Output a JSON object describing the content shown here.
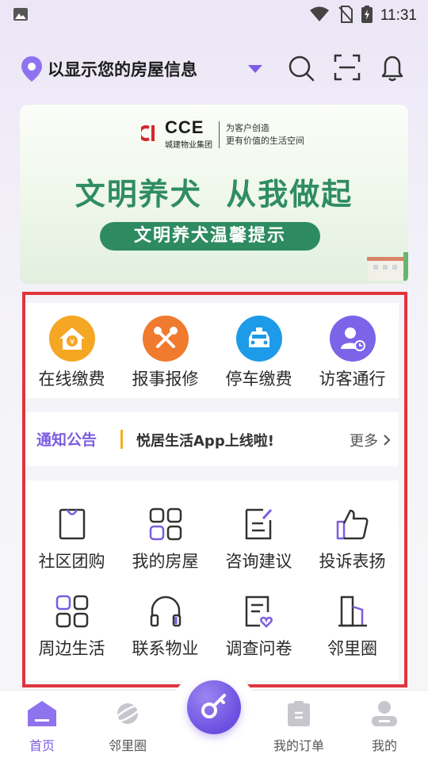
{
  "status_bar": {
    "time": "11:31"
  },
  "header": {
    "address": "以显示您的房屋信息"
  },
  "banner": {
    "brand_name": "CCE",
    "brand_sub": "城建物业集团",
    "slogan_line1": "为客户创造",
    "slogan_line2": "更有价值的生活空间",
    "headline": "文明养犬  从我做起",
    "pill": "文明养犬温馨提示"
  },
  "services": [
    {
      "label": "在线缴费",
      "icon": "house-yen-icon",
      "color": "#f5a623"
    },
    {
      "label": "报事报修",
      "icon": "tools-icon",
      "color": "#f07a2e"
    },
    {
      "label": "停车缴费",
      "icon": "car-icon",
      "color": "#1e9be8"
    },
    {
      "label": "访客通行",
      "icon": "visitor-icon",
      "color": "#7c64e8"
    }
  ],
  "notice": {
    "tag": "通知公告",
    "text": "悦居生活App上线啦!",
    "more": "更多"
  },
  "grid": [
    {
      "label": "社区团购",
      "icon": "shopping-bag-icon"
    },
    {
      "label": "我的房屋",
      "icon": "grid-squares-icon"
    },
    {
      "label": "咨询建议",
      "icon": "document-pen-icon"
    },
    {
      "label": "投诉表扬",
      "icon": "thumbs-up-icon"
    },
    {
      "label": "周边生活",
      "icon": "grid-squares-icon"
    },
    {
      "label": "联系物业",
      "icon": "headphones-icon"
    },
    {
      "label": "调查问卷",
      "icon": "questionnaire-icon"
    },
    {
      "label": "邻里圈",
      "icon": "building-icon"
    }
  ],
  "tabs": [
    {
      "label": "首页",
      "icon": "home-icon",
      "active": true
    },
    {
      "label": "邻里圈",
      "icon": "planet-icon",
      "active": false
    },
    {
      "label": "我的订单",
      "icon": "clipboard-icon",
      "active": false
    },
    {
      "label": "我的",
      "icon": "user-icon",
      "active": false
    }
  ],
  "colors": {
    "accent": "#7c5ce0",
    "highlight_frame": "#e0353c",
    "banner_green": "#2e8b61"
  }
}
